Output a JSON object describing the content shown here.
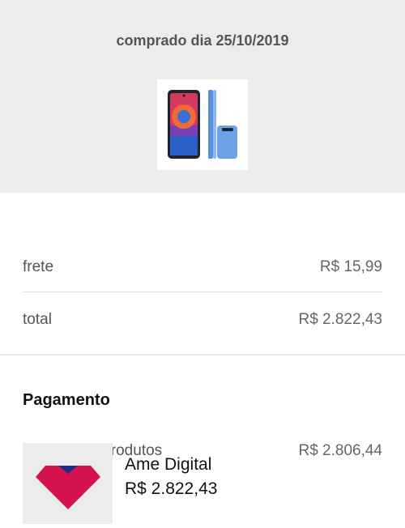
{
  "header": {
    "purchase_date": "comprado dia 25/10/2019",
    "product_image": "samsung-galaxy-phone-thumbnail"
  },
  "summary": {
    "products_label": "valor dos 2 produtos",
    "products_value": "R$ 2.806,44",
    "freight_label": "frete",
    "freight_value": "R$ 15,99",
    "total_label": "total",
    "total_value": "R$ 2.822,43"
  },
  "payment": {
    "title": "Pagamento",
    "logo_icon": "ame-digital-logo",
    "method": "Ame Digital",
    "amount": "R$ 2.822,43"
  }
}
